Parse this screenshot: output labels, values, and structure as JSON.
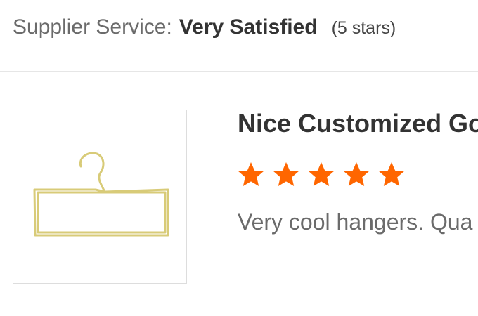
{
  "supplier": {
    "label": "Supplier Service:",
    "value": "Very Satisfied",
    "stars_text": "(5 stars)"
  },
  "review": {
    "image_icon": "hanger-icon",
    "title": "Nice Customized Go",
    "rating": 5,
    "rating_max": 5,
    "star_color": "#ff6600",
    "text": "Very cool hangers. Qua"
  }
}
